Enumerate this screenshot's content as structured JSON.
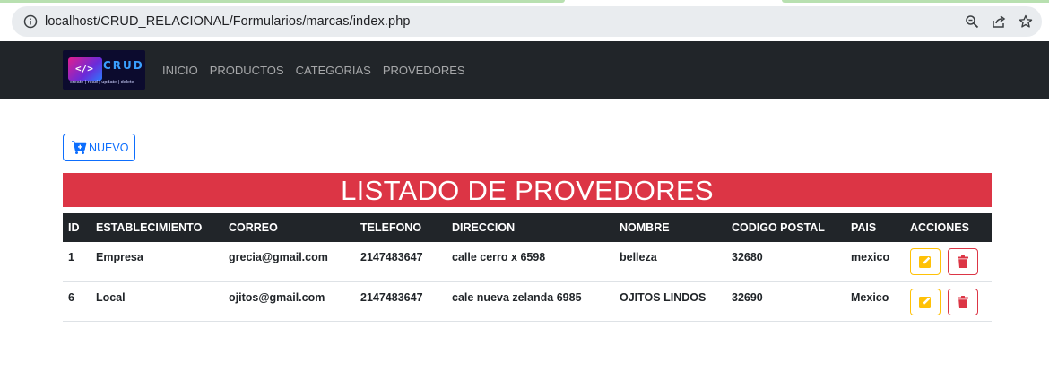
{
  "browser": {
    "url": "localhost/CRUD_RELACIONAL/Formularios/marcas/index.php"
  },
  "navbar": {
    "logo_title": "CRUD",
    "logo_code": "</>",
    "logo_sub": "create | read | update | delete",
    "links": [
      "INICIO",
      "PRODUCTOS",
      "CATEGORIAS",
      "PROVEDORES"
    ]
  },
  "toolbar": {
    "new_label": "NUEVO"
  },
  "page": {
    "title": "LISTADO DE PROVEDORES"
  },
  "table": {
    "headers": [
      "ID",
      "ESTABLECIMIENTO",
      "CORREO",
      "TELEFONO",
      "DIRECCION",
      "NOMBRE",
      "CODIGO POSTAL",
      "PAIS",
      "ACCIONES"
    ],
    "rows": [
      [
        "1",
        "Empresa",
        "grecia@gmail.com",
        "2147483647",
        "calle cerro x 6598",
        "belleza",
        "32680",
        "mexico"
      ],
      [
        "6",
        "Local",
        "ojitos@gmail.com",
        "2147483647",
        "cale nueva zelanda 6985",
        "OJITOS LINDOS",
        "32690",
        "Mexico"
      ]
    ]
  },
  "colors": {
    "navbar_bg": "#212529",
    "primary": "#0d6efd",
    "danger": "#dc3545",
    "warning": "#ffc107"
  },
  "icons": {
    "address_info": "info-icon",
    "zoom": "zoom-icon",
    "share": "share-icon",
    "bookmark": "star-icon",
    "new": "cart-plus-icon",
    "edit": "edit-icon",
    "delete": "trash-icon"
  }
}
